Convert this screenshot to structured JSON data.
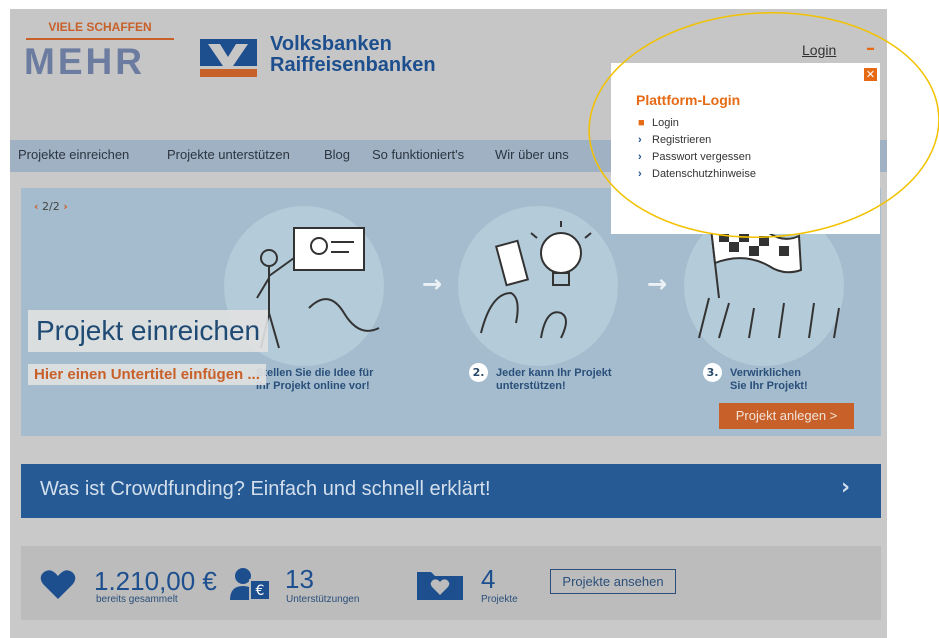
{
  "header": {
    "tagline": "VIELE SCHAFFEN",
    "tagline_big": "MEHR",
    "bank_line1": "Volksbanken",
    "bank_line2": "Raiffeisenbanken",
    "login_label": "Login"
  },
  "nav": {
    "items": [
      {
        "label": "Projekte einreichen"
      },
      {
        "label": "Projekte unterstützen"
      },
      {
        "label": "Blog"
      },
      {
        "label": "So funktioniert's"
      },
      {
        "label": "Wir über uns"
      }
    ]
  },
  "slider": {
    "pager": "2/2",
    "title": "Projekt einreichen",
    "subtitle": "Hier einen Untertitel einfügen ...",
    "steps": [
      {
        "num": "",
        "line1": "Stellen Sie die Idee für",
        "line2": "Ihr Projekt online vor!"
      },
      {
        "num": "2.",
        "line1": "Jeder kann Ihr Projekt",
        "line2": "unterstützen!"
      },
      {
        "num": "3.",
        "line1": "Verwirklichen",
        "line2": "Sie Ihr Projekt!"
      }
    ],
    "cta_label": "Projekt anlegen >"
  },
  "banner": {
    "text": "Was ist Crowdfunding? Einfach und schnell erklärt!"
  },
  "stats": {
    "amount": "1.210,00 €",
    "amount_label": "bereits gesammelt",
    "supporters": "13",
    "supporters_label": "Unterstützungen",
    "projects": "4",
    "projects_label": "Projekte",
    "button_label": "Projekte ansehen"
  },
  "popup": {
    "title": "Plattform-Login",
    "items": [
      {
        "label": "Login",
        "icon": "lock-icon"
      },
      {
        "label": "Registrieren",
        "icon": "chevron-right-icon"
      },
      {
        "label": "Passwort vergessen",
        "icon": "chevron-right-icon"
      },
      {
        "label": "Datenschutzhinweise",
        "icon": "chevron-right-icon"
      }
    ]
  },
  "colors": {
    "accent_orange": "#e66a14",
    "brand_blue": "#1d4f8f",
    "highlight_yellow": "#f2c200"
  }
}
